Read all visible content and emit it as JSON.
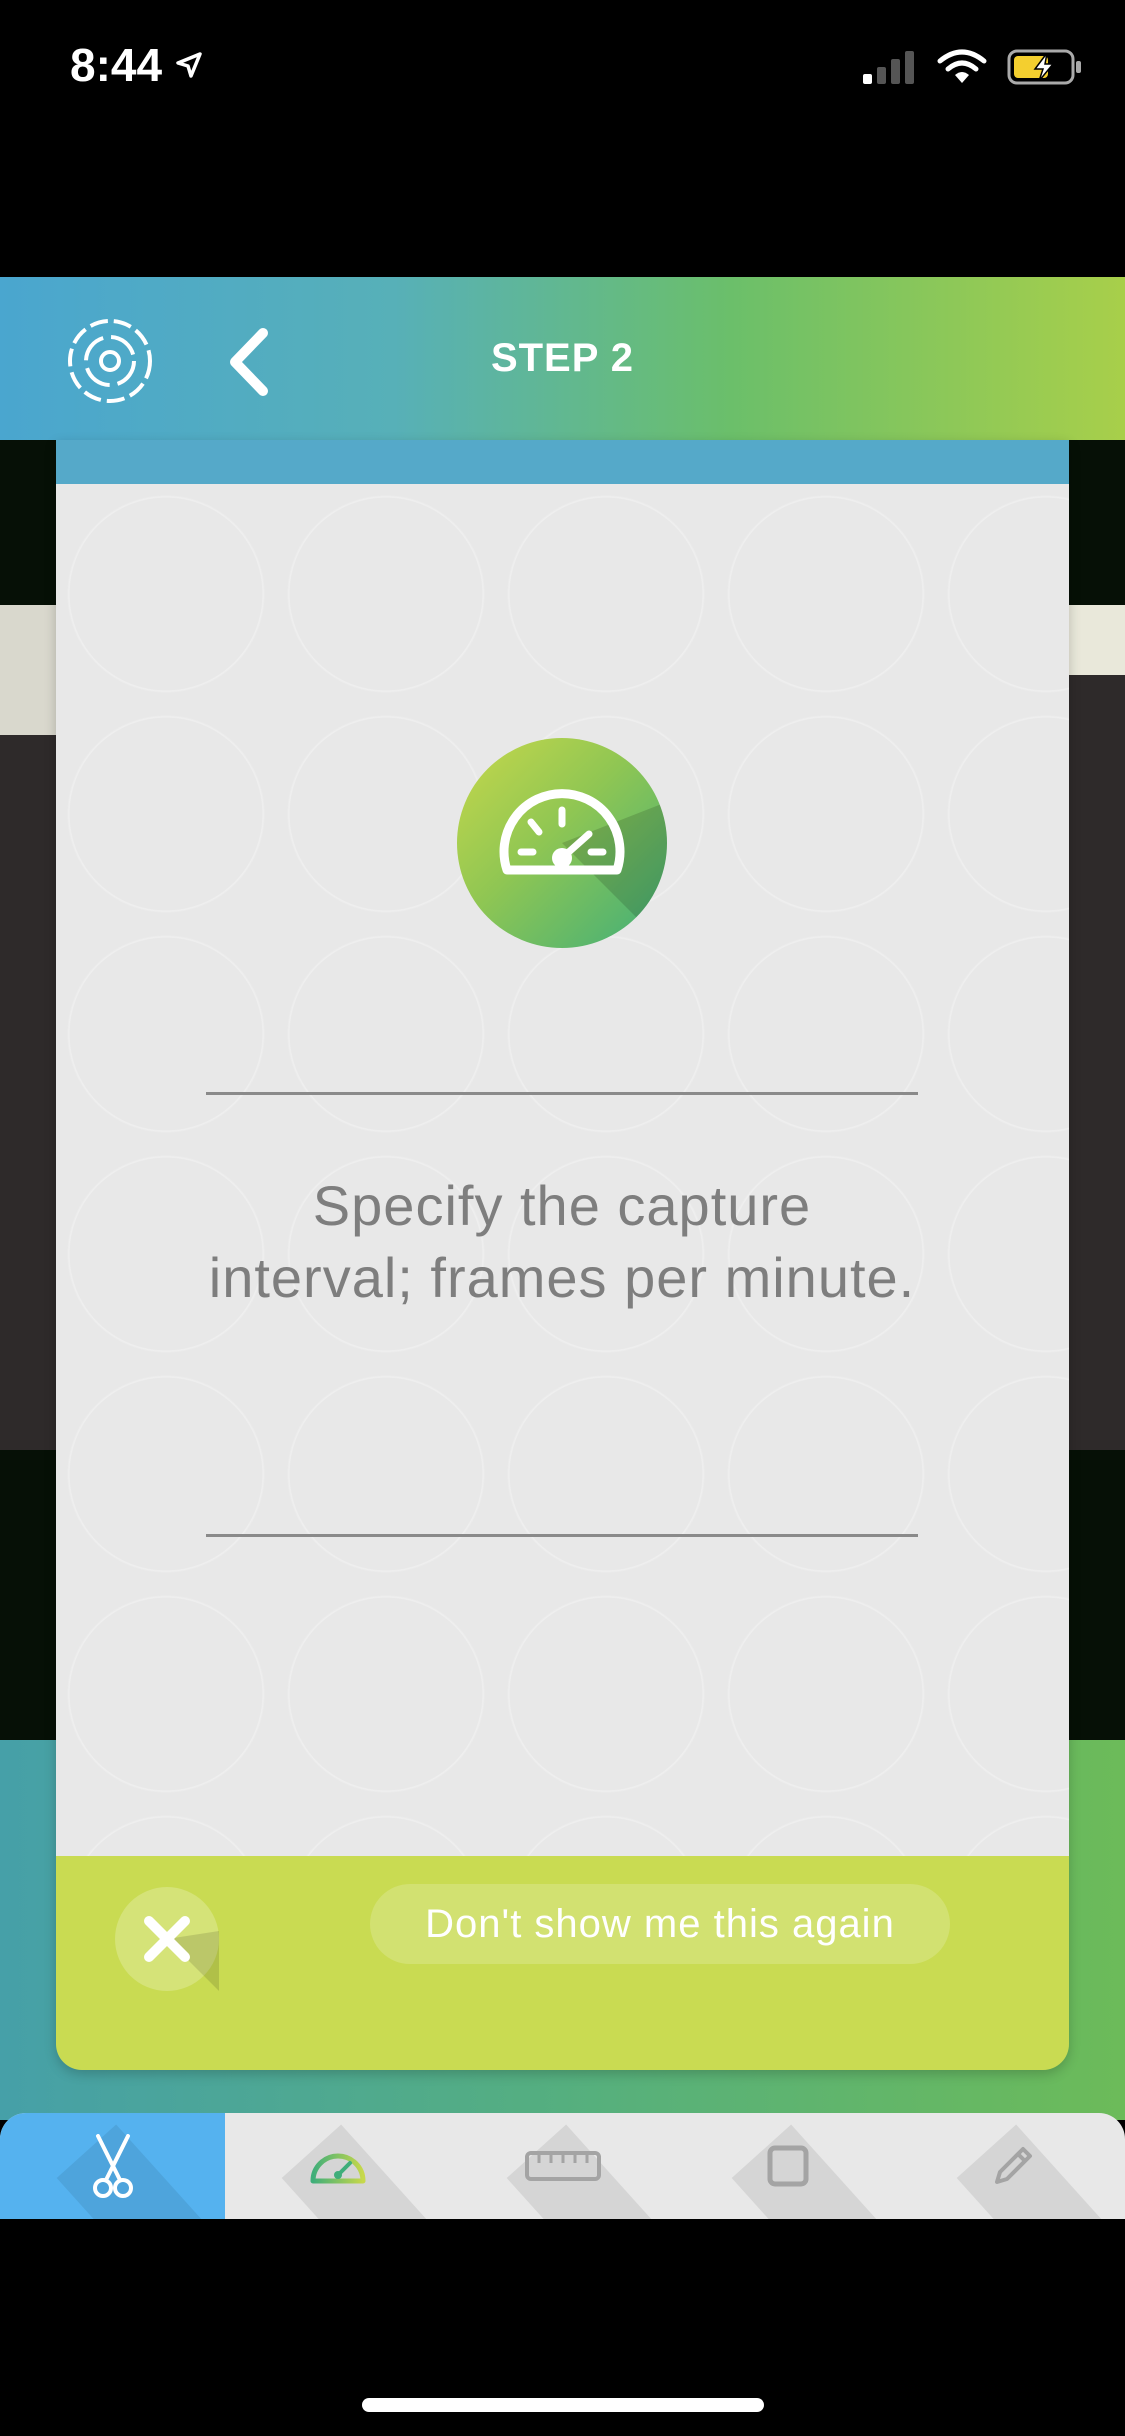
{
  "status_bar": {
    "time": "8:44",
    "signal_icon": "cellular-signal-icon",
    "wifi_icon": "wifi-icon",
    "battery_icon": "battery-charging-icon"
  },
  "header": {
    "title": "STEP 2",
    "logo_icon": "app-logo-icon",
    "back_icon": "chevron-left-icon"
  },
  "card": {
    "icon": "speedometer-icon",
    "instruction": "Specify the capture interval; frames per minute.",
    "dont_show_label": "Don't show me this again",
    "close_icon": "close-icon"
  },
  "toolbar": {
    "items": [
      {
        "name": "scissors-icon",
        "active": true
      },
      {
        "name": "speedometer-icon",
        "active": false
      },
      {
        "name": "ruler-icon",
        "active": false
      },
      {
        "name": "square-icon",
        "active": false
      },
      {
        "name": "pencil-icon",
        "active": false
      }
    ]
  },
  "colors": {
    "header_gradient_start": "#4aa6cf",
    "header_gradient_end": "#a8cf4a",
    "footer": "#c9db52",
    "active_tool": "#55b2ef"
  }
}
